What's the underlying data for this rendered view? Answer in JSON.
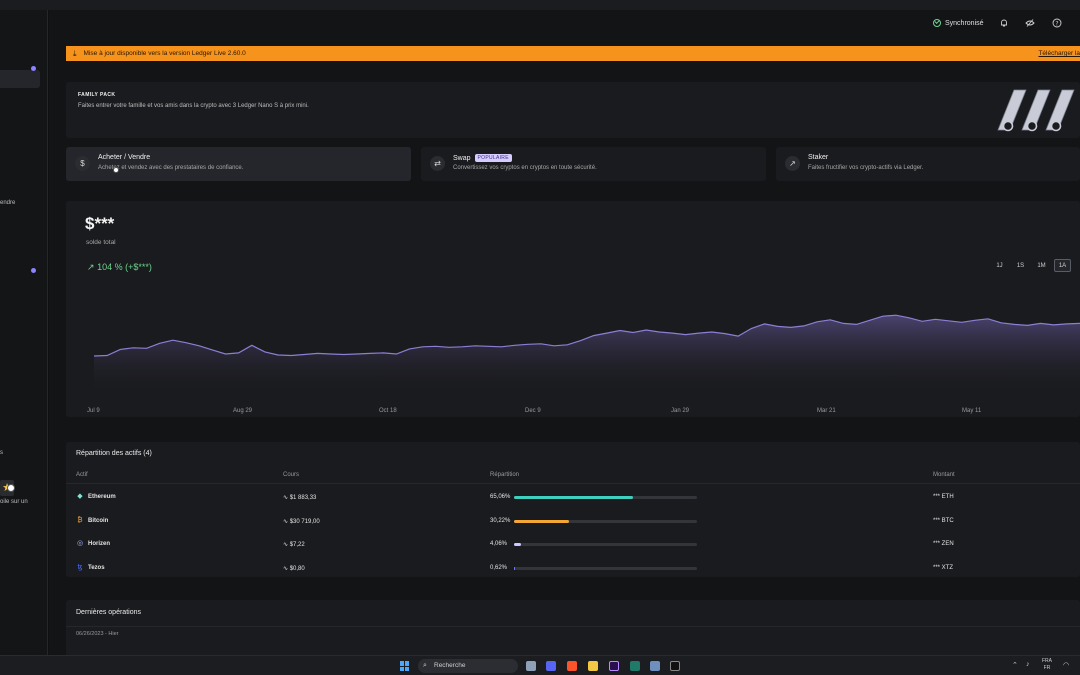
{
  "topbar": {
    "sync_label": "Synchronisé",
    "icons": [
      "bell-icon",
      "eye-slash-icon",
      "help-icon"
    ]
  },
  "sidebar": {
    "fragments": [
      "endre",
      "s",
      "oile sur un"
    ]
  },
  "banner": {
    "text": "Mise à jour disponible vers la version Ledger Live 2.60.0",
    "link": "Télécharger la"
  },
  "promo": {
    "title": "FAMILY PACK",
    "text": "Faites entrer votre famille et vos amis dans la crypto avec 3 Ledger Nano S à prix mini."
  },
  "actions": [
    {
      "title": "Acheter / Vendre",
      "desc": "Achetez et vendez avec des prestataires de confiance.",
      "icon": "dollar-icon",
      "badge": ""
    },
    {
      "title": "Swap",
      "desc": "Convertissez vos cryptos en cryptos en toute sécurité.",
      "icon": "swap-arrows-icon",
      "badge": "POPULAIRE"
    },
    {
      "title": "Staker",
      "desc": "Faites fructifier vos crypto-actifs via Ledger.",
      "icon": "chart-up-icon",
      "badge": ""
    }
  ],
  "balance": {
    "value": "$***",
    "label": "solde total",
    "change": "104 % (+$***)",
    "periods": [
      "1J",
      "1S",
      "1M",
      "1A"
    ],
    "selected_period": "1A"
  },
  "chart_data": {
    "type": "area",
    "x_ticks": [
      "Jul 9",
      "Aug 29",
      "Oct 18",
      "Dec 9",
      "Jan 29",
      "Mar 21",
      "May 11"
    ],
    "series": [
      {
        "values": [
          0.0,
          0.01,
          0.13,
          0.16,
          0.15,
          0.25,
          0.31,
          0.26,
          0.2,
          0.12,
          0.04,
          0.06,
          0.21,
          0.08,
          0.02,
          0.01,
          0.03,
          0.05,
          0.04,
          0.03,
          0.04,
          0.05,
          0.06,
          0.04,
          0.14,
          0.18,
          0.19,
          0.17,
          0.18,
          0.2,
          0.19,
          0.18,
          0.21,
          0.23,
          0.24,
          0.2,
          0.22,
          0.3,
          0.4,
          0.45,
          0.5,
          0.46,
          0.51,
          0.47,
          0.45,
          0.42,
          0.45,
          0.47,
          0.44,
          0.39,
          0.54,
          0.63,
          0.58,
          0.56,
          0.59,
          0.67,
          0.71,
          0.64,
          0.62,
          0.7,
          0.78,
          0.8,
          0.75,
          0.68,
          0.72,
          0.69,
          0.66,
          0.7,
          0.73,
          0.65,
          0.62,
          0.6,
          0.64,
          0.61,
          0.63,
          0.64
        ]
      }
    ],
    "yaxis_hidden": true,
    "color": "#8b7fd4"
  },
  "assets": {
    "title": "Répartition des actifs (4)",
    "headers": [
      "Actif",
      "Cours",
      "Répartition",
      "Montant"
    ],
    "rows": [
      {
        "name": "Ethereum",
        "price": "$1 883,33",
        "pct": "65,06%",
        "share": 65.06,
        "amount": "*** ETH",
        "color": "#3ecfbf",
        "icon": "ethereum-icon",
        "glyph": "◆",
        "glyph_color": "#7fe3d6"
      },
      {
        "name": "Bitcoin",
        "price": "$30 719,00",
        "pct": "30,22%",
        "share": 30.22,
        "amount": "*** BTC",
        "color": "#f4a634",
        "icon": "bitcoin-icon",
        "glyph": "₿",
        "glyph_color": "#f4a634"
      },
      {
        "name": "Horizen",
        "price": "$7,22",
        "pct": "4,06%",
        "share": 4.06,
        "amount": "*** ZEN",
        "color": "#cfc7ff",
        "icon": "horizen-icon",
        "glyph": "◎",
        "glyph_color": "#a8b4ff"
      },
      {
        "name": "Tezos",
        "price": "$0,80",
        "pct": "0,62%",
        "share": 0.62,
        "amount": "*** XTZ",
        "color": "#6f7cff",
        "icon": "tezos-icon",
        "glyph": "ꜩ",
        "glyph_color": "#4b6cff"
      }
    ]
  },
  "operations": {
    "title": "Dernières opérations",
    "date": "06/26/2023 - Hier"
  },
  "taskbar": {
    "search": "Recherche",
    "lang_1": "FRA",
    "lang_2": "FR",
    "colors": {
      "start": "#4aa8ff"
    }
  }
}
